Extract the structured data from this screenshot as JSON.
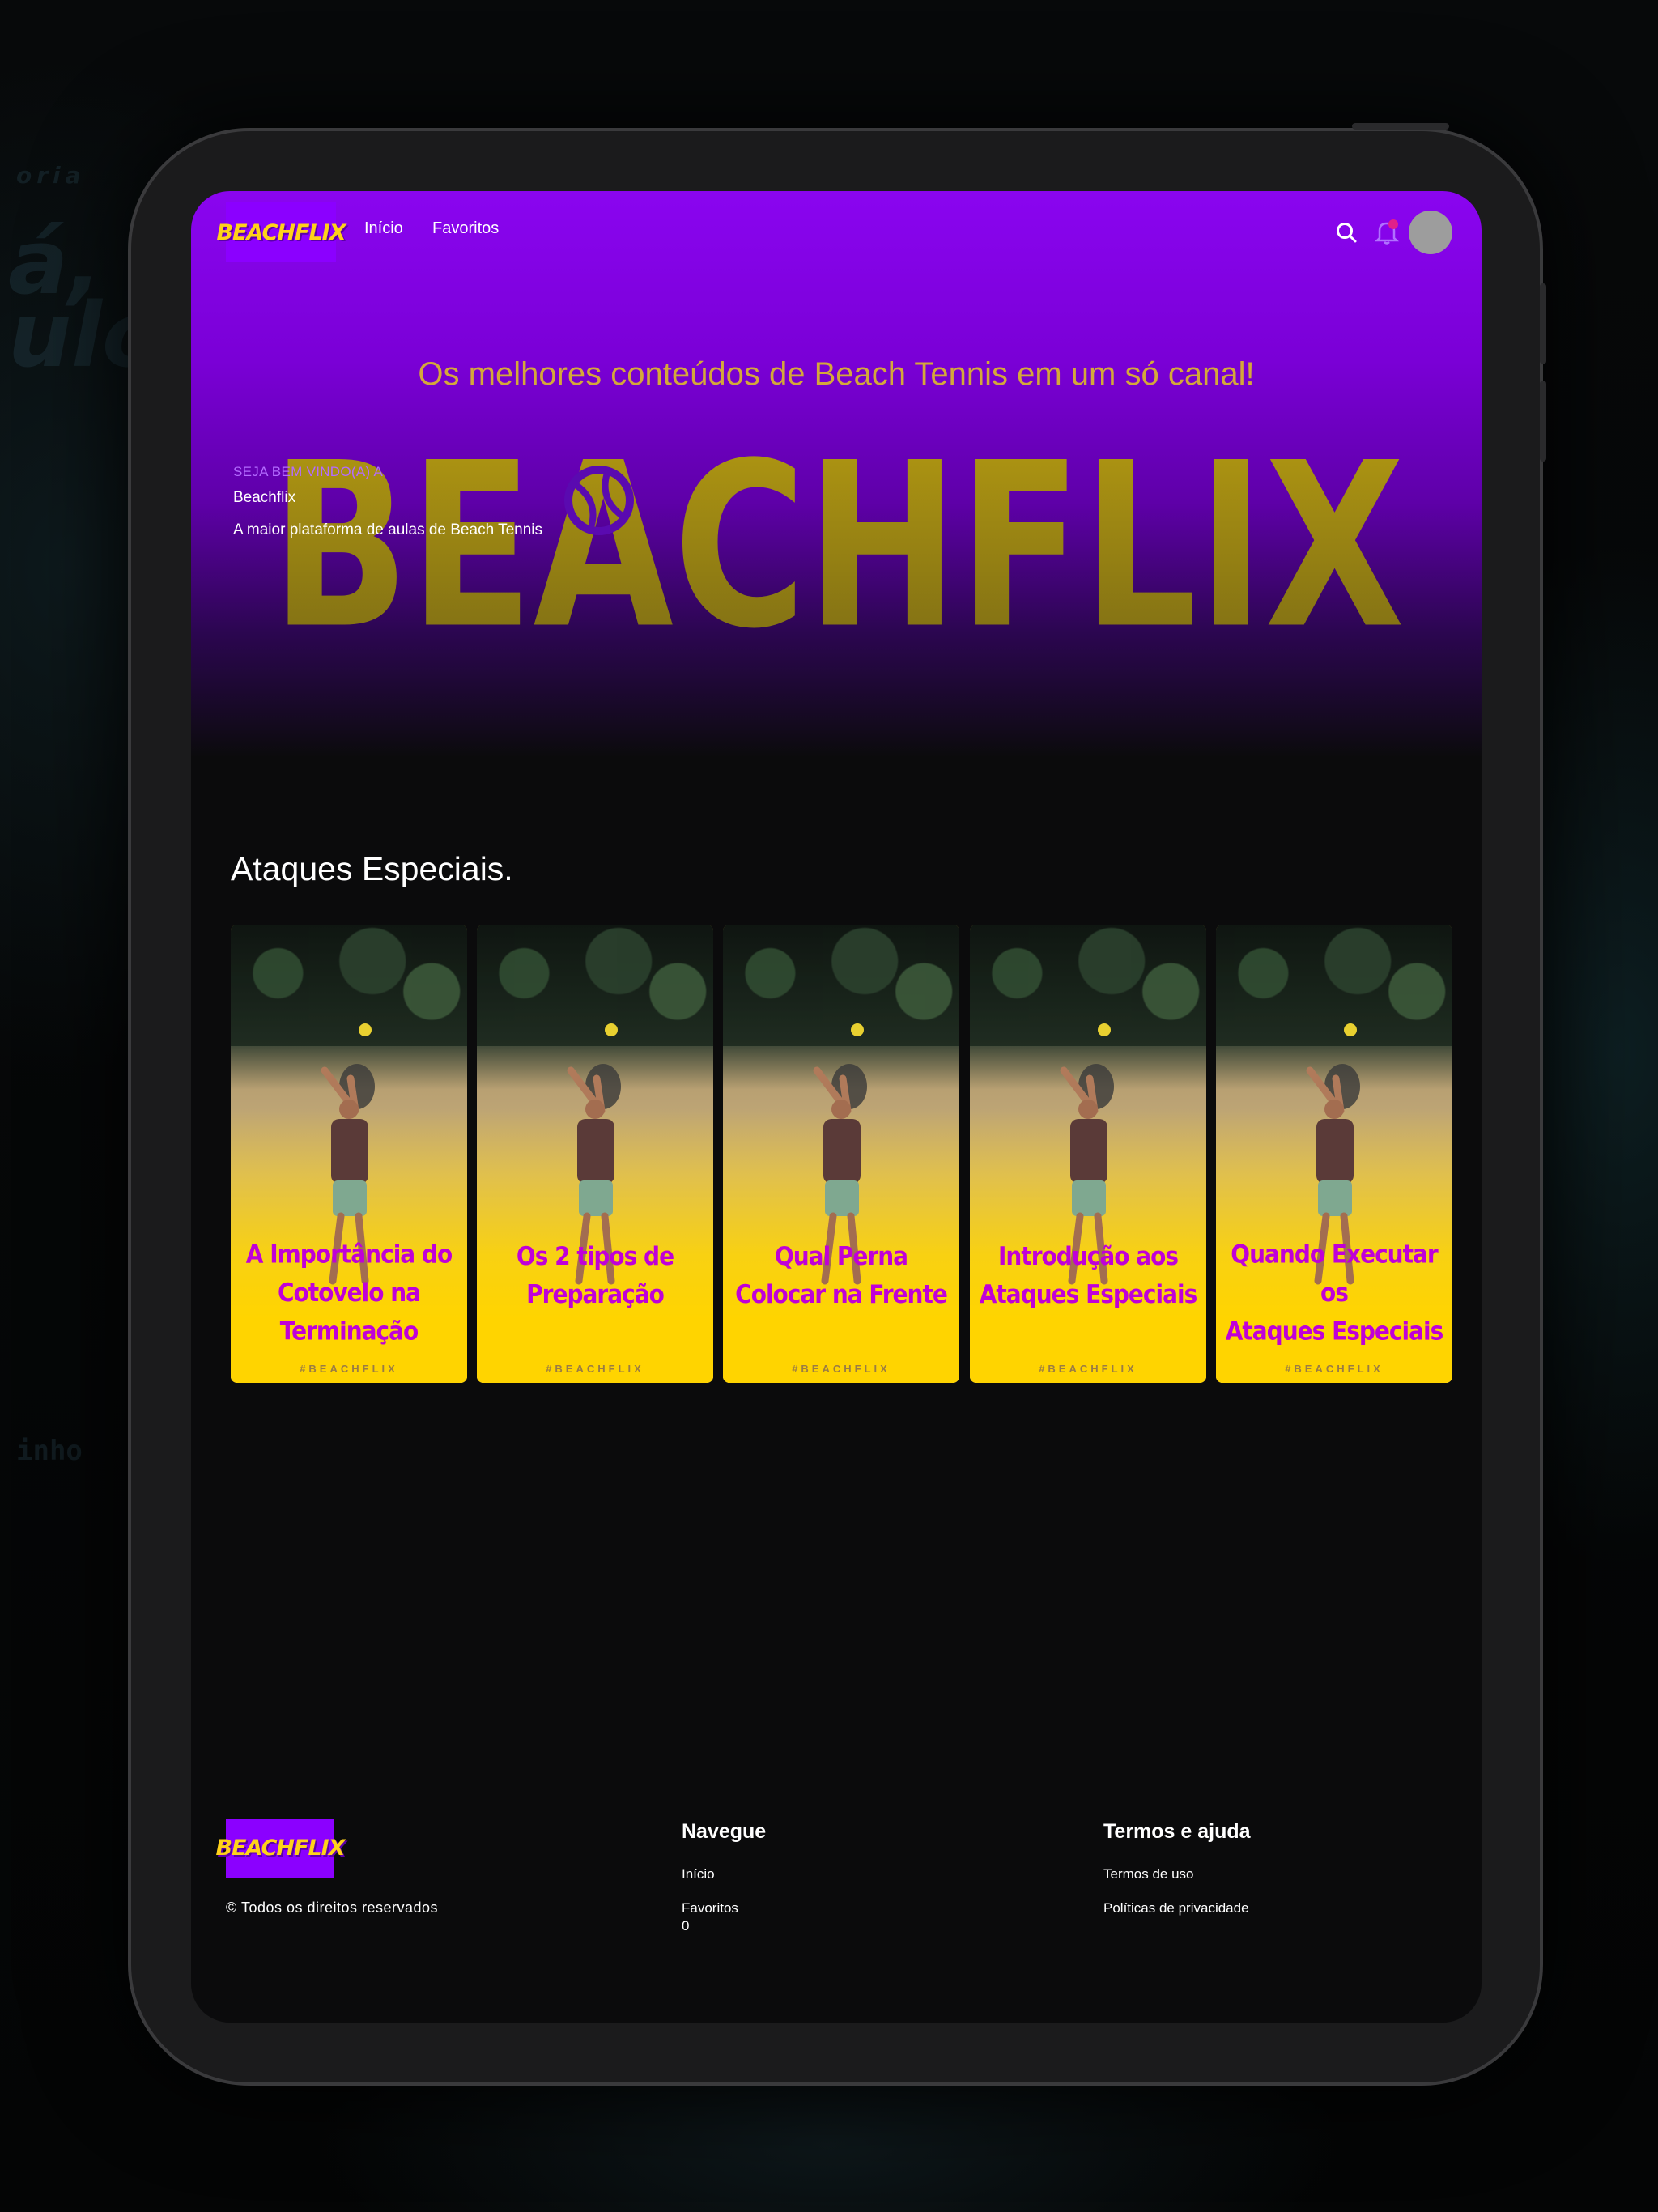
{
  "brand": {
    "logo_text": "BEACHFLIX",
    "purple": "#8b00ff",
    "yellow": "#ffd21a"
  },
  "nav": {
    "links": [
      "Início",
      "Favoritos"
    ],
    "notification_dot_color": "#e0208a"
  },
  "hero": {
    "tagline": "Os melhores conteúdos de Beach Tennis em um só canal!",
    "big_word": "BEACHFLIX",
    "welcome": "SEJA BEM VINDO(A) A",
    "title": "Beachflix",
    "description": "A maior plataforma de aulas de Beach Tennis"
  },
  "section": {
    "title": "Ataques Especiais.",
    "cards": [
      {
        "title_lines": [
          "A Importância do",
          "Cotovelo na",
          "Terminação"
        ],
        "tag": "#BEACHFLIX"
      },
      {
        "title_lines": [
          "Os 2 tipos de",
          "Preparação"
        ],
        "tag": "#BEACHFLIX"
      },
      {
        "title_lines": [
          "Qual Perna",
          "Colocar na Frente"
        ],
        "tag": "#BEACHFLIX"
      },
      {
        "title_lines": [
          "Introdução aos",
          "Ataques Especiais"
        ],
        "tag": "#BEACHFLIX"
      },
      {
        "title_lines": [
          "Quando Executar os",
          "Ataques Especiais"
        ],
        "tag": "#BEACHFLIX"
      }
    ]
  },
  "footer": {
    "copyright": "© Todos os direitos reservados",
    "navegue": {
      "heading": "Navegue",
      "links": [
        "Início",
        "Favoritos"
      ],
      "favorites_count": "0"
    },
    "termos": {
      "heading": "Termos e ajuda",
      "links": [
        "Termos de uso",
        "Políticas de privacidade"
      ]
    }
  },
  "background_words": [
    "á, se",
    "ulo",
    "oria",
    "inho"
  ]
}
